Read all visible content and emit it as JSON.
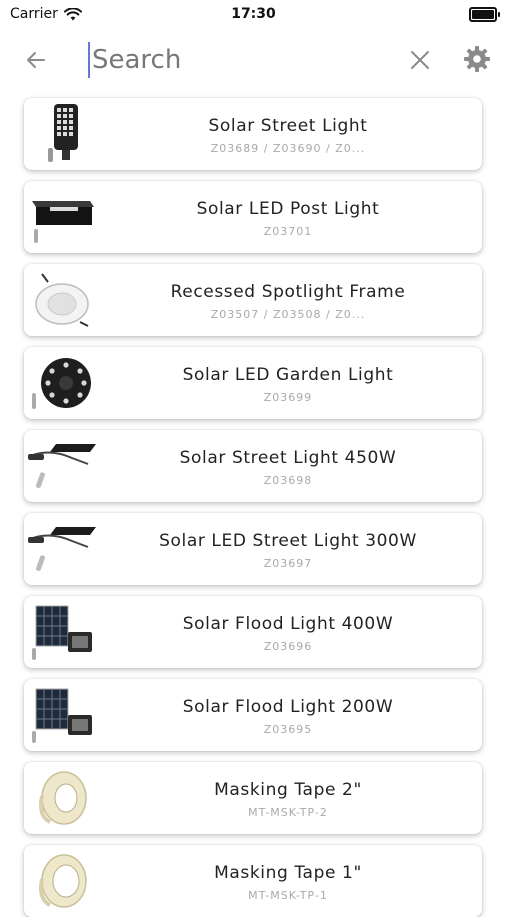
{
  "status": {
    "carrier": "Carrier",
    "time": "17:30"
  },
  "search": {
    "placeholder": "Search"
  },
  "icons": {
    "back": "arrow-left-icon",
    "clear": "close-icon",
    "settings": "gear-icon",
    "wifi": "wifi-icon",
    "battery": "battery-icon"
  },
  "products": [
    {
      "title": "Solar Street Light",
      "code": "Z03689 / Z03690 / Z0...",
      "image": "solar-street-light-image"
    },
    {
      "title": "Solar LED Post Light",
      "code": "Z03701",
      "image": "post-light-image"
    },
    {
      "title": "Recessed Spotlight Frame",
      "code": "Z03507 / Z03508 / Z0...",
      "image": "spotlight-frame-image"
    },
    {
      "title": "Solar LED Garden Light",
      "code": "Z03699",
      "image": "garden-light-image"
    },
    {
      "title": "Solar Street Light 450W",
      "code": "Z03698",
      "image": "street-light-panel-image"
    },
    {
      "title": "Solar LED Street Light 300W",
      "code": "Z03697",
      "image": "street-light-panel-image"
    },
    {
      "title": "Solar Flood Light 400W",
      "code": "Z03696",
      "image": "flood-light-image"
    },
    {
      "title": "Solar Flood Light 200W",
      "code": "Z03695",
      "image": "flood-light-image"
    },
    {
      "title": "Masking Tape 2\"",
      "code": "MT-MSK-TP-2",
      "image": "masking-tape-image"
    },
    {
      "title": "Masking Tape 1\"",
      "code": "MT-MSK-TP-1",
      "image": "masking-tape-image"
    }
  ]
}
